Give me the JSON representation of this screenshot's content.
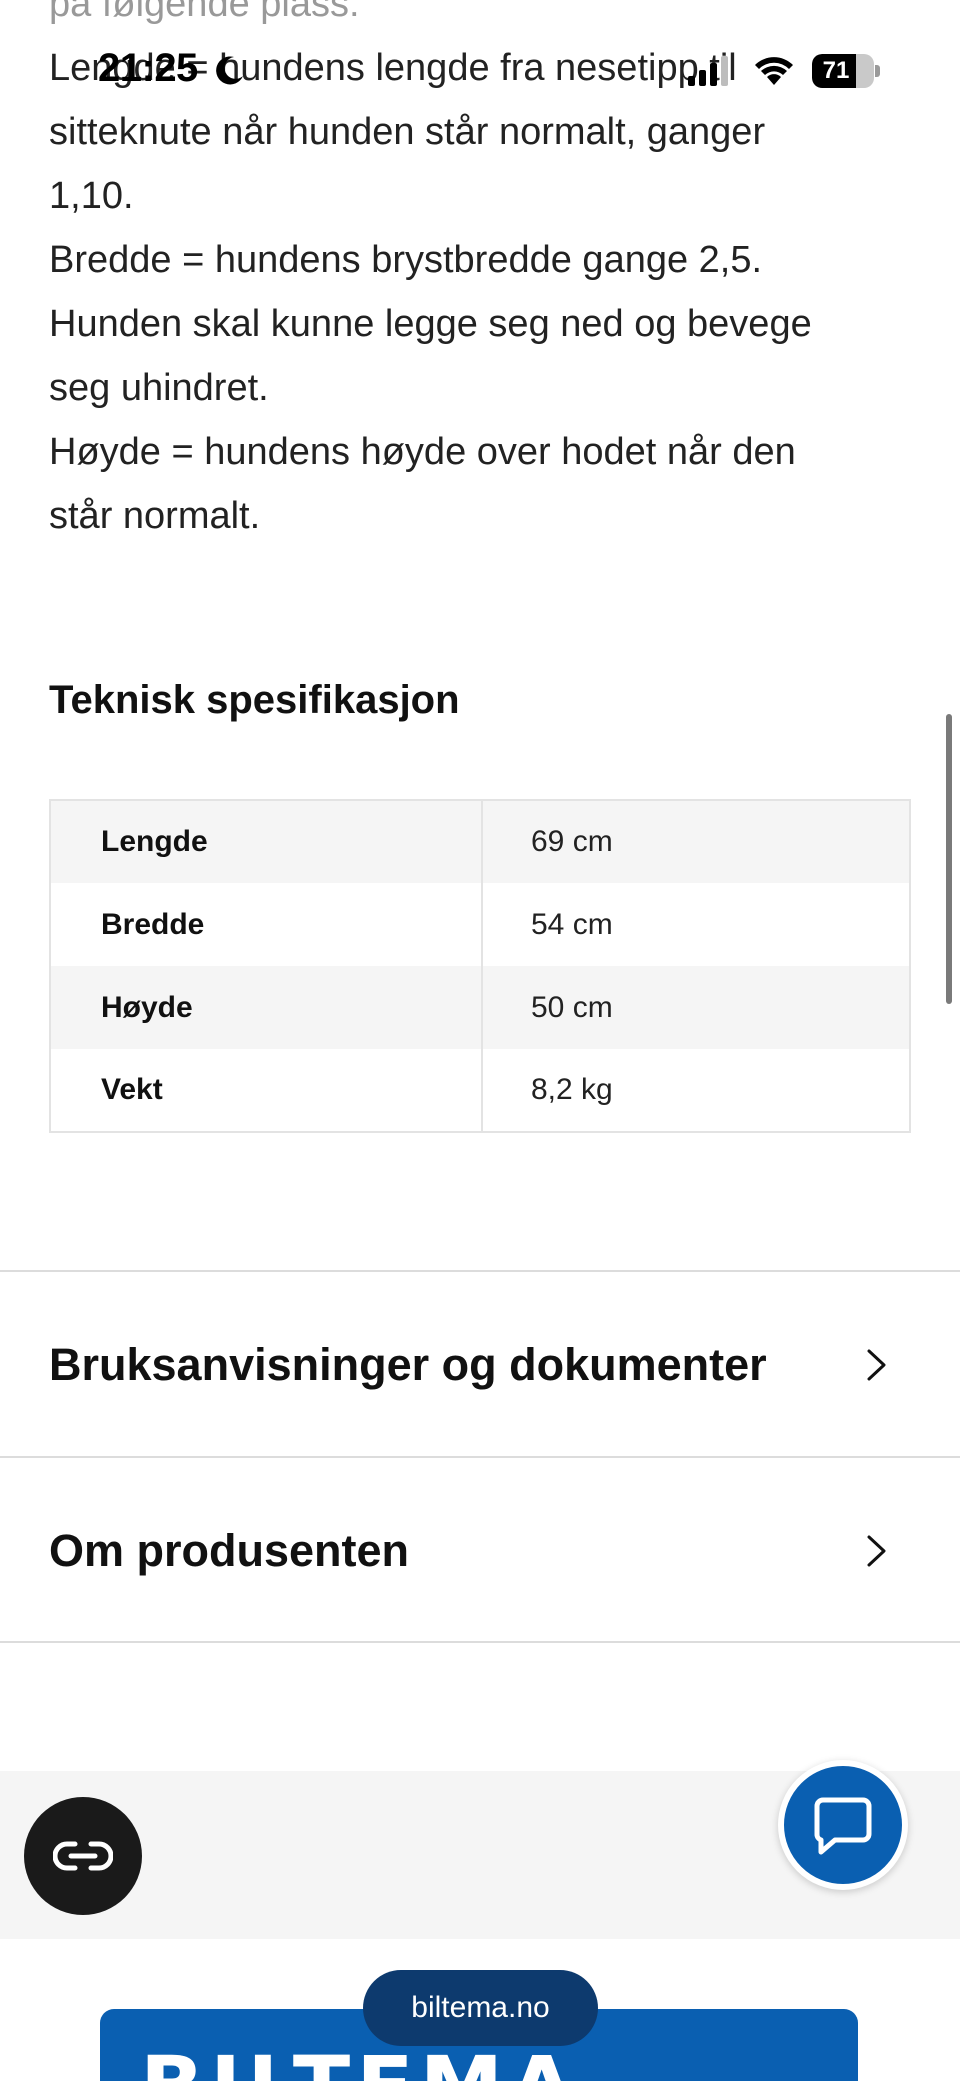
{
  "status_bar": {
    "time": "21:25",
    "battery_level": "71",
    "battery_fraction": 0.71,
    "icons": [
      "moon-icon",
      "signal-icon",
      "wifi-icon",
      "battery-icon"
    ]
  },
  "article": {
    "lines": [
      "på følgende plass:",
      "Lengde = hundens lengde fra nesetipp til",
      "sitteknute når hunden står normalt, ganger",
      "1,10.",
      "Bredde = hundens brystbredde gange 2,5.",
      "Hunden skal kunne legge seg ned og bevege",
      "seg uhindret.",
      "Høyde = hundens høyde over hodet når den",
      "står normalt."
    ]
  },
  "spec": {
    "title": "Teknisk spesifikasjon",
    "rows": [
      {
        "key": "Lengde",
        "value": "69 cm"
      },
      {
        "key": "Bredde",
        "value": "54 cm"
      },
      {
        "key": "Høyde",
        "value": "50 cm"
      },
      {
        "key": "Vekt",
        "value": "8,2 kg"
      }
    ]
  },
  "sections": [
    {
      "label": "Bruksanvisninger og dokumenter"
    },
    {
      "label": "Om produsenten"
    }
  ],
  "footer": {
    "url": "biltema.no",
    "brand": "BILTEMA"
  },
  "colors": {
    "brand_blue": "#0a5fb1",
    "url_pill": "#0d3a6e",
    "reader_button": "#1a1a1a"
  }
}
